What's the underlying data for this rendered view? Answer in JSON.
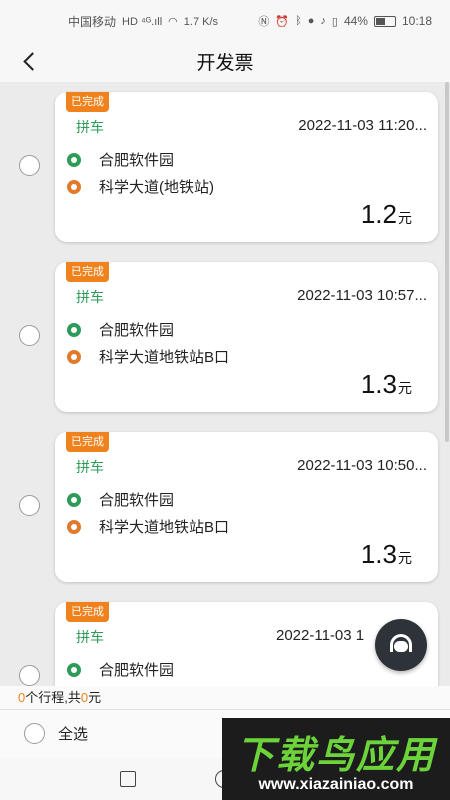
{
  "status_bar": {
    "carrier": "中国移动",
    "network": "HD ⁴ᴳ.ıll",
    "speed": "1.7 K/s",
    "icons": [
      "nfc-icon",
      "alarm-icon",
      "bluetooth-icon",
      "location-icon",
      "mic-icon",
      "vibrate-icon"
    ],
    "battery": "44%",
    "time": "10:18"
  },
  "header": {
    "back_icon": "chevron-left-icon",
    "title": "开发票"
  },
  "trips": [
    {
      "status": "已完成",
      "type": "拼车",
      "time": "2022-11-03 11:20...",
      "from": "合肥软件园",
      "to": "科学大道(地铁站)",
      "price": "1.2",
      "unit": "元"
    },
    {
      "status": "已完成",
      "type": "拼车",
      "time": "2022-11-03 10:57...",
      "from": "合肥软件园",
      "to": "科学大道地铁站B口",
      "price": "1.3",
      "unit": "元"
    },
    {
      "status": "已完成",
      "type": "拼车",
      "time": "2022-11-03 10:50...",
      "from": "合肥软件园",
      "to": "科学大道地铁站B口",
      "price": "1.3",
      "unit": "元"
    },
    {
      "status": "已完成",
      "type": "拼车",
      "time": "2022-11-03 1",
      "from": "合肥软件园",
      "to": "",
      "price": "",
      "unit": ""
    }
  ],
  "summary": {
    "count": "0",
    "count_suffix": "个行程,共",
    "amount": "0",
    "amount_suffix": "元"
  },
  "footer": {
    "select_all_label": "全选"
  },
  "support": {
    "icon": "headset-icon"
  },
  "watermark": {
    "title": "下载鸟应用",
    "url": "www.xiazainiao.com"
  },
  "colors": {
    "accent": "#f0821e",
    "green": "#2e9b58",
    "orange_pin": "#e07a2e"
  }
}
